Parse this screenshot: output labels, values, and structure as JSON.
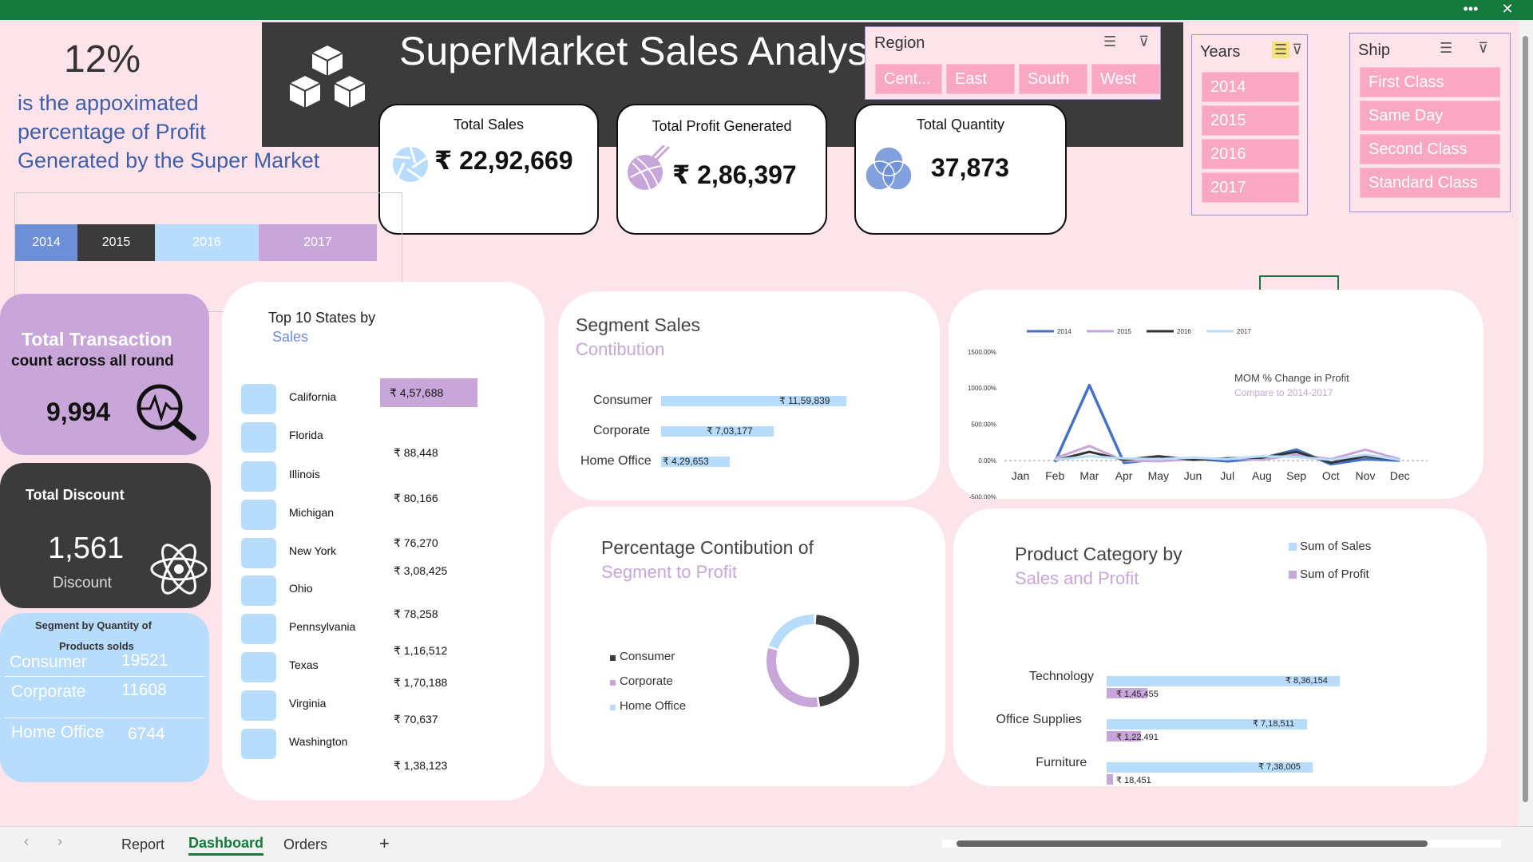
{
  "window": {
    "more": "•••",
    "close": "✕"
  },
  "header": {
    "percent": "12%",
    "percent_text": [
      "is the appoximated",
      "percentage of Profit",
      "Generated by the Super Market"
    ],
    "title": "SuperMarket Sales Analysis"
  },
  "kpis": {
    "sales": {
      "label": "Total Sales",
      "value": "₹ 22,92,669"
    },
    "profit": {
      "label": "Total  Profit Generated",
      "value": "₹ 2,86,397"
    },
    "quantity": {
      "label": "Total Quantity",
      "value": "37,873"
    }
  },
  "slicers": {
    "region": {
      "title": "Region",
      "items": [
        "Cent...",
        "East",
        "South",
        "West"
      ]
    },
    "years": {
      "title": "Years",
      "items": [
        "2014",
        "2015",
        "2016",
        "2017"
      ]
    },
    "ship": {
      "title": "Ship",
      "items": [
        "First Class",
        "Same Day",
        "Second Class",
        "Standard Class"
      ]
    }
  },
  "year_buttons": [
    "2014",
    "2015",
    "2016",
    "2017"
  ],
  "transactions": {
    "title": "Total  Transaction",
    "subtitle": "count across all round",
    "value": "9,994"
  },
  "discount": {
    "title": "Total Discount",
    "value": "1,561",
    "label": "Discount"
  },
  "segment_qty": {
    "title_line1": "Segment by  Quantity of",
    "title_line2": "Products solds",
    "rows": [
      {
        "name": "Consumer",
        "value": "19521"
      },
      {
        "name": "Corporate",
        "value": "11608"
      },
      {
        "name": "Home Office",
        "value": "6744"
      }
    ]
  },
  "top_states": {
    "title": "Top 10 States by",
    "subtitle": "Sales",
    "states": [
      {
        "name": "California",
        "value": "₹ 4,57,688"
      },
      {
        "name": "Florida",
        "value": "₹ 88,448"
      },
      {
        "name": "Illinois",
        "value": "₹ 80,166"
      },
      {
        "name": "Michigan",
        "value": "₹ 76,270"
      },
      {
        "name": "New York",
        "value": "₹ 3,08,425"
      },
      {
        "name": "Ohio",
        "value": "₹ 78,258"
      },
      {
        "name": "Pennsylvania",
        "value": "₹ 1,16,512"
      },
      {
        "name": "Texas",
        "value": "₹ 1,70,188"
      },
      {
        "name": "Virginia",
        "value": "₹ 70,637"
      },
      {
        "name": "Washington",
        "value": "₹ 1,38,123"
      }
    ]
  },
  "segment_sales": {
    "title": "Segment Sales",
    "subtitle": "Contibution",
    "bars": [
      {
        "name": "Consumer",
        "value": 1159839,
        "label": "₹ 11,59,839"
      },
      {
        "name": "Corporate",
        "value": 703177,
        "label": "₹ 7,03,177"
      },
      {
        "name": "Home Office",
        "value": 429653,
        "label": "₹ 4,29,653"
      }
    ]
  },
  "mom_chart": {
    "title": "MOM % Change in Profit",
    "subtitle": "Compare to 2014-2017",
    "legend": [
      "2014",
      "2015",
      "2016",
      "2017"
    ],
    "colors": [
      "#4472c4",
      "#c9a6d9",
      "#333333",
      "#b8dcfb"
    ],
    "y_ticks": [
      "1500.00%",
      "1000.00%",
      "500.00%",
      "0.00%",
      "-500.00%"
    ],
    "y_values": [
      1500,
      1000,
      500,
      0,
      -500
    ],
    "months": [
      "Jan",
      "Feb",
      "Mar",
      "Apr",
      "May",
      "Jun",
      "Jul",
      "Aug",
      "Sep",
      "Oct",
      "Nov",
      "Dec"
    ]
  },
  "chart_data": {
    "type": "line",
    "title": "MOM % Change in Profit",
    "subtitle": "Compare to 2014-2017",
    "categories": [
      "Jan",
      "Feb",
      "Mar",
      "Apr",
      "May",
      "Jun",
      "Jul",
      "Aug",
      "Sep",
      "Oct",
      "Nov",
      "Dec"
    ],
    "ylim": [
      -500,
      1500
    ],
    "series": [
      {
        "name": "2014",
        "values": [
          null,
          -20,
          1040,
          -30,
          20,
          30,
          -10,
          30,
          150,
          -50,
          20,
          0
        ]
      },
      {
        "name": "2015",
        "values": [
          null,
          30,
          200,
          0,
          -10,
          20,
          30,
          10,
          80,
          20,
          150,
          20
        ]
      },
      {
        "name": "2016",
        "values": [
          null,
          0,
          120,
          10,
          60,
          10,
          30,
          40,
          120,
          -30,
          60,
          10
        ]
      },
      {
        "name": "2017",
        "values": [
          null,
          10,
          60,
          30,
          20,
          40,
          20,
          60,
          50,
          10,
          80,
          10
        ]
      }
    ]
  },
  "pct_contribution": {
    "title": "Percentage Contibution of",
    "subtitle": "Segment to Profit",
    "legend": [
      "Consumer",
      "Corporate",
      "Home Office"
    ],
    "colors": [
      "#3b3b3b",
      "#c9a6d9",
      "#b8dcfb"
    ],
    "shares": [
      0.47,
      0.32,
      0.21
    ]
  },
  "product_category": {
    "title": "Product Category by",
    "subtitle": "Sales and Profit",
    "legend": [
      "Sum of Sales",
      "Sum of Profit"
    ],
    "rows": [
      {
        "name": "Technology",
        "sales": 836154,
        "sales_label": "₹ 8,36,154",
        "profit": 145455,
        "profit_label": "₹ 1,45,455"
      },
      {
        "name": "Office Supplies",
        "sales": 718511,
        "sales_label": "₹ 7,18,511",
        "profit": 122491,
        "profit_label": "₹ 1,22,491"
      },
      {
        "name": "Furniture",
        "sales": 738005,
        "sales_label": "₹ 7,38,005",
        "profit": 18451,
        "profit_label": "₹ 18,451"
      }
    ]
  },
  "tabs": [
    "Report",
    "Dashboard",
    "Orders"
  ],
  "tab_add": "+"
}
